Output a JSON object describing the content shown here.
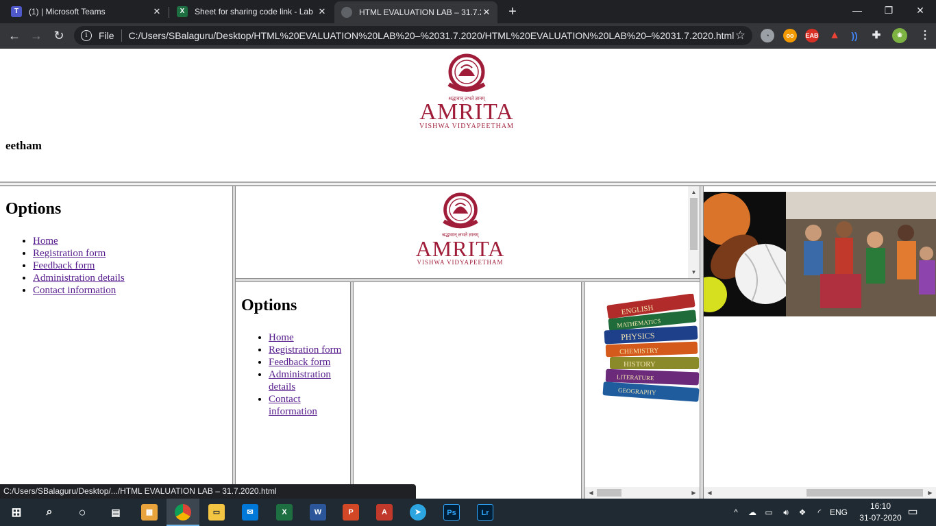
{
  "browser": {
    "tabs": [
      {
        "title": "(1) | Microsoft Teams",
        "icon": "teams-icon",
        "active": false
      },
      {
        "title": "Sheet for sharing code link - Lab",
        "icon": "excel-icon",
        "active": false
      },
      {
        "title": "HTML EVALUATION LAB – 31.7.20",
        "icon": "globe-icon",
        "active": true
      }
    ],
    "new_tab": "+",
    "omnibox": {
      "scheme_label": "File",
      "url": "C:/Users/SBalaguru/Desktop/HTML%20EVALUATION%20LAB%20–%2031.7.2020/HTML%20EVALUATION%20LAB%20–%2031.7.2020.html"
    },
    "status_url": "C:/Users/SBalaguru/Desktop/.../HTML EVALUATION LAB – 31.7.2020.html"
  },
  "page": {
    "logo": {
      "wordmark": "AMRITA",
      "tagline": "VISHWA VIDYAPEETHAM",
      "motto": "श्रद्धावान् लभते ज्ञानम्"
    },
    "marquee_text": "eetham",
    "left_frame": {
      "title": "Options",
      "links": [
        "Home",
        "Registration form",
        "Feedback form",
        "Administration details",
        "Contact information"
      ]
    },
    "nested_frame": {
      "title": "Options",
      "links": [
        "Home",
        "Registration form",
        "Feedback form",
        "Administration details",
        "Contact information"
      ]
    },
    "books": [
      "ENGLISH",
      "MATHEMATICS",
      "PHYSICS",
      "CHEMISTRY",
      "HISTORY",
      "LITERATURE",
      "GEOGRAPHY"
    ]
  },
  "taskbar": {
    "tray_language": "ENG",
    "clock_time": "16:10",
    "clock_date": "31-07-2020"
  },
  "colors": {
    "brand": "#a01d3a",
    "link_visited": "#551a8b",
    "chrome_dark": "#202124",
    "taskbar": "#1f2a33"
  }
}
